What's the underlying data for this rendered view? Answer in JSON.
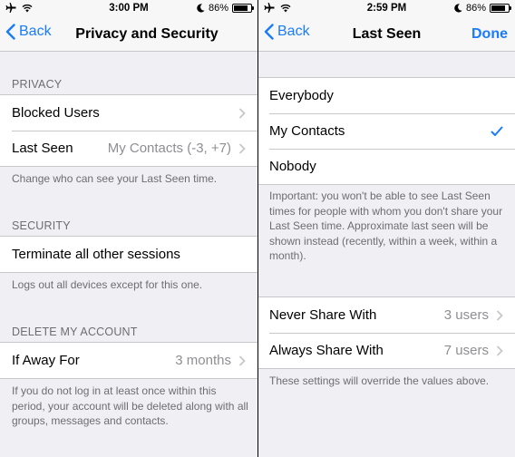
{
  "left": {
    "status": {
      "time": "3:00 PM",
      "battery": "86%",
      "battery_level": 0.86
    },
    "nav": {
      "back_label": "Back",
      "title": "Privacy and Security"
    },
    "privacy": {
      "header": "PRIVACY",
      "blocked_users": "Blocked Users",
      "last_seen_label": "Last Seen",
      "last_seen_value": "My Contacts (-3, +7)",
      "footer": "Change who can see your Last Seen time."
    },
    "security": {
      "header": "SECURITY",
      "terminate": "Terminate all other sessions",
      "footer": "Logs out all devices except for this one."
    },
    "delete": {
      "header": "DELETE MY ACCOUNT",
      "if_away_label": "If Away For",
      "if_away_value": "3 months",
      "footer": "If you do not log in at least once within this period, your account will be deleted along with all groups, messages and contacts."
    }
  },
  "right": {
    "status": {
      "time": "2:59 PM",
      "battery": "86%",
      "battery_level": 0.86
    },
    "nav": {
      "back_label": "Back",
      "title": "Last Seen",
      "done_label": "Done"
    },
    "options": {
      "everybody": "Everybody",
      "my_contacts": "My Contacts",
      "nobody": "Nobody",
      "selected": "My Contacts",
      "footer": "Important: you won't be able to see Last Seen times for people with whom you don't share your Last Seen time. Approximate last seen will be shown instead (recently, within a week, within a month)."
    },
    "exceptions": {
      "never_label": "Never Share With",
      "never_value": "3 users",
      "always_label": "Always Share With",
      "always_value": "7 users",
      "footer": "These settings will override the values above."
    }
  },
  "colors": {
    "accent": "#1a7cf8",
    "background": "#efeff4",
    "separator": "#c8c7cc",
    "secondary_text": "#6d6d72"
  },
  "icons": [
    "airplane-icon",
    "wifi-icon",
    "moon-icon",
    "battery-icon",
    "chevron-left-icon",
    "chevron-right-icon",
    "checkmark-icon"
  ]
}
